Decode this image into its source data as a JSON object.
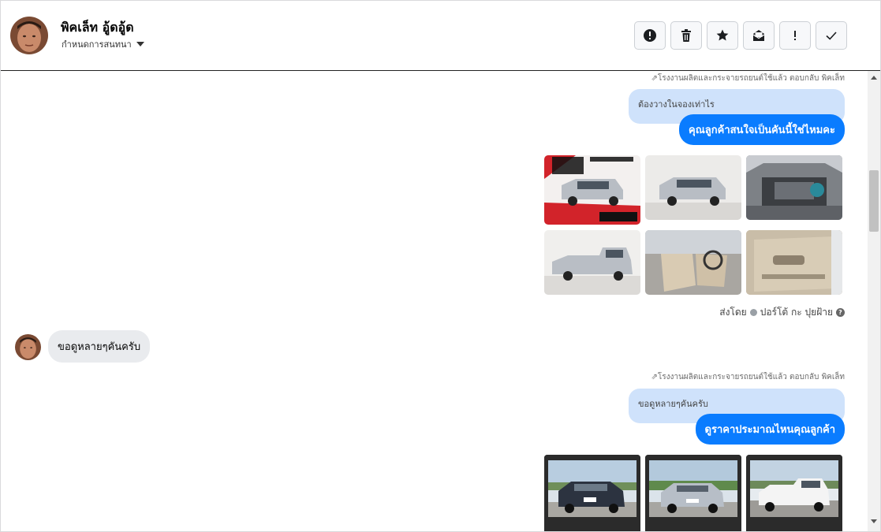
{
  "header": {
    "name": "พิคเล็ท อู้ดอู้ด",
    "subtitle": "กำหนดการสนทนา",
    "actions": [
      {
        "icon": "alert-circle-icon",
        "label": "!"
      },
      {
        "icon": "trash-icon"
      },
      {
        "icon": "star-icon"
      },
      {
        "icon": "mail-icon"
      },
      {
        "icon": "exclamation-icon",
        "label": "!"
      },
      {
        "icon": "check-icon"
      }
    ]
  },
  "messages": {
    "m1": {
      "meta": "โรงงานผลิตและกระจายรถยนต์ใช้แล้ว ตอบกลับ พิคเล็ท",
      "replied_to": "ต้องวางในจองเท่าไร",
      "text": "คุณลูกค้าสนใจเป็นคันนี้ใช่ไหมคะ",
      "thumb_count": 6
    },
    "sent_by": {
      "prefix": "ส่งโดย",
      "name": "ปอร์โต้ กะ ปุยฝ้าย"
    },
    "m2": {
      "text": "ขอดูหลายๆคันครับ"
    },
    "m3": {
      "meta": "โรงงานผลิตและกระจายรถยนต์ใช้แล้ว ตอบกลับ พิคเล็ท",
      "replied_to": "ขอดูหลายๆคันครับ",
      "text": "ดูราคาประมาณไหนคุณลูกค้า",
      "thumb_count": 3
    }
  },
  "colors": {
    "accent": "#0a7cff",
    "reply_bg": "#cfe2fb",
    "incoming_bg": "#e9ebee"
  }
}
